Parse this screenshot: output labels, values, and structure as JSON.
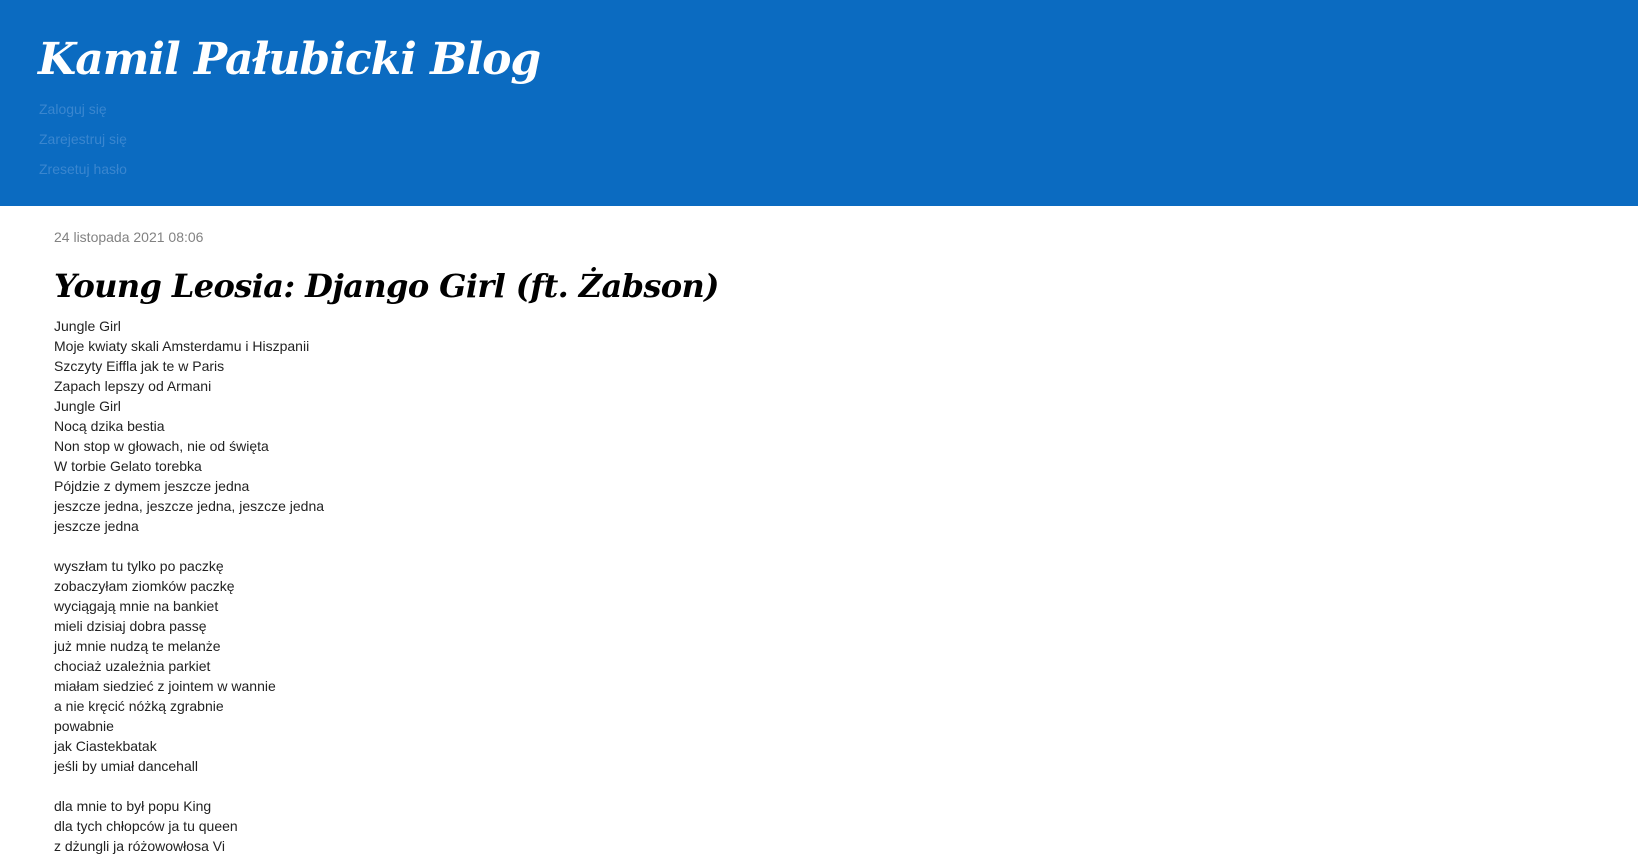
{
  "header": {
    "site_title": "Kamil Pałubicki Blog",
    "nav": {
      "login": "Zaloguj się",
      "register": "Zarejestruj się",
      "reset_password": "Zresetuj hasło"
    },
    "background_color": "#0b6bc1"
  },
  "post": {
    "date": "24 listopada 2021 08:06",
    "title": "Young Leosia: Django Girl (ft. Żabson)",
    "stanzas": [
      {
        "lines": [
          "Jungle Girl",
          "Moje kwiaty skali Amsterdamu i Hiszpanii",
          "Szczyty Eiffla jak te w Paris",
          "Zapach lepszy od Armani",
          "Jungle Girl",
          "Nocą dzika bestia",
          "Non stop w głowach, nie od święta",
          "W torbie Gelato torebka",
          "Pójdzie z dymem jeszcze jedna",
          "jeszcze jedna, jeszcze jedna, jeszcze jedna",
          "jeszcze jedna"
        ]
      },
      {
        "lines": [
          "wyszłam tu tylko po paczkę",
          "zobaczyłam ziomków paczkę",
          "wyciągają mnie na bankiet",
          "mieli dzisiaj dobra passę",
          "już mnie nudzą te melanże",
          "chociaż uzależnia parkiet",
          "miałam siedzieć z jointem w wannie",
          "a nie kręcić nóżką zgrabnie",
          "powabnie",
          "jak Ciastekbatak",
          "jeśli by umiał dancehall"
        ]
      },
      {
        "lines": [
          "dla mnie to był popu King",
          "dla tych chłopców ja tu queen",
          "z dżungli ja różowowłosa Vi"
        ]
      }
    ]
  }
}
